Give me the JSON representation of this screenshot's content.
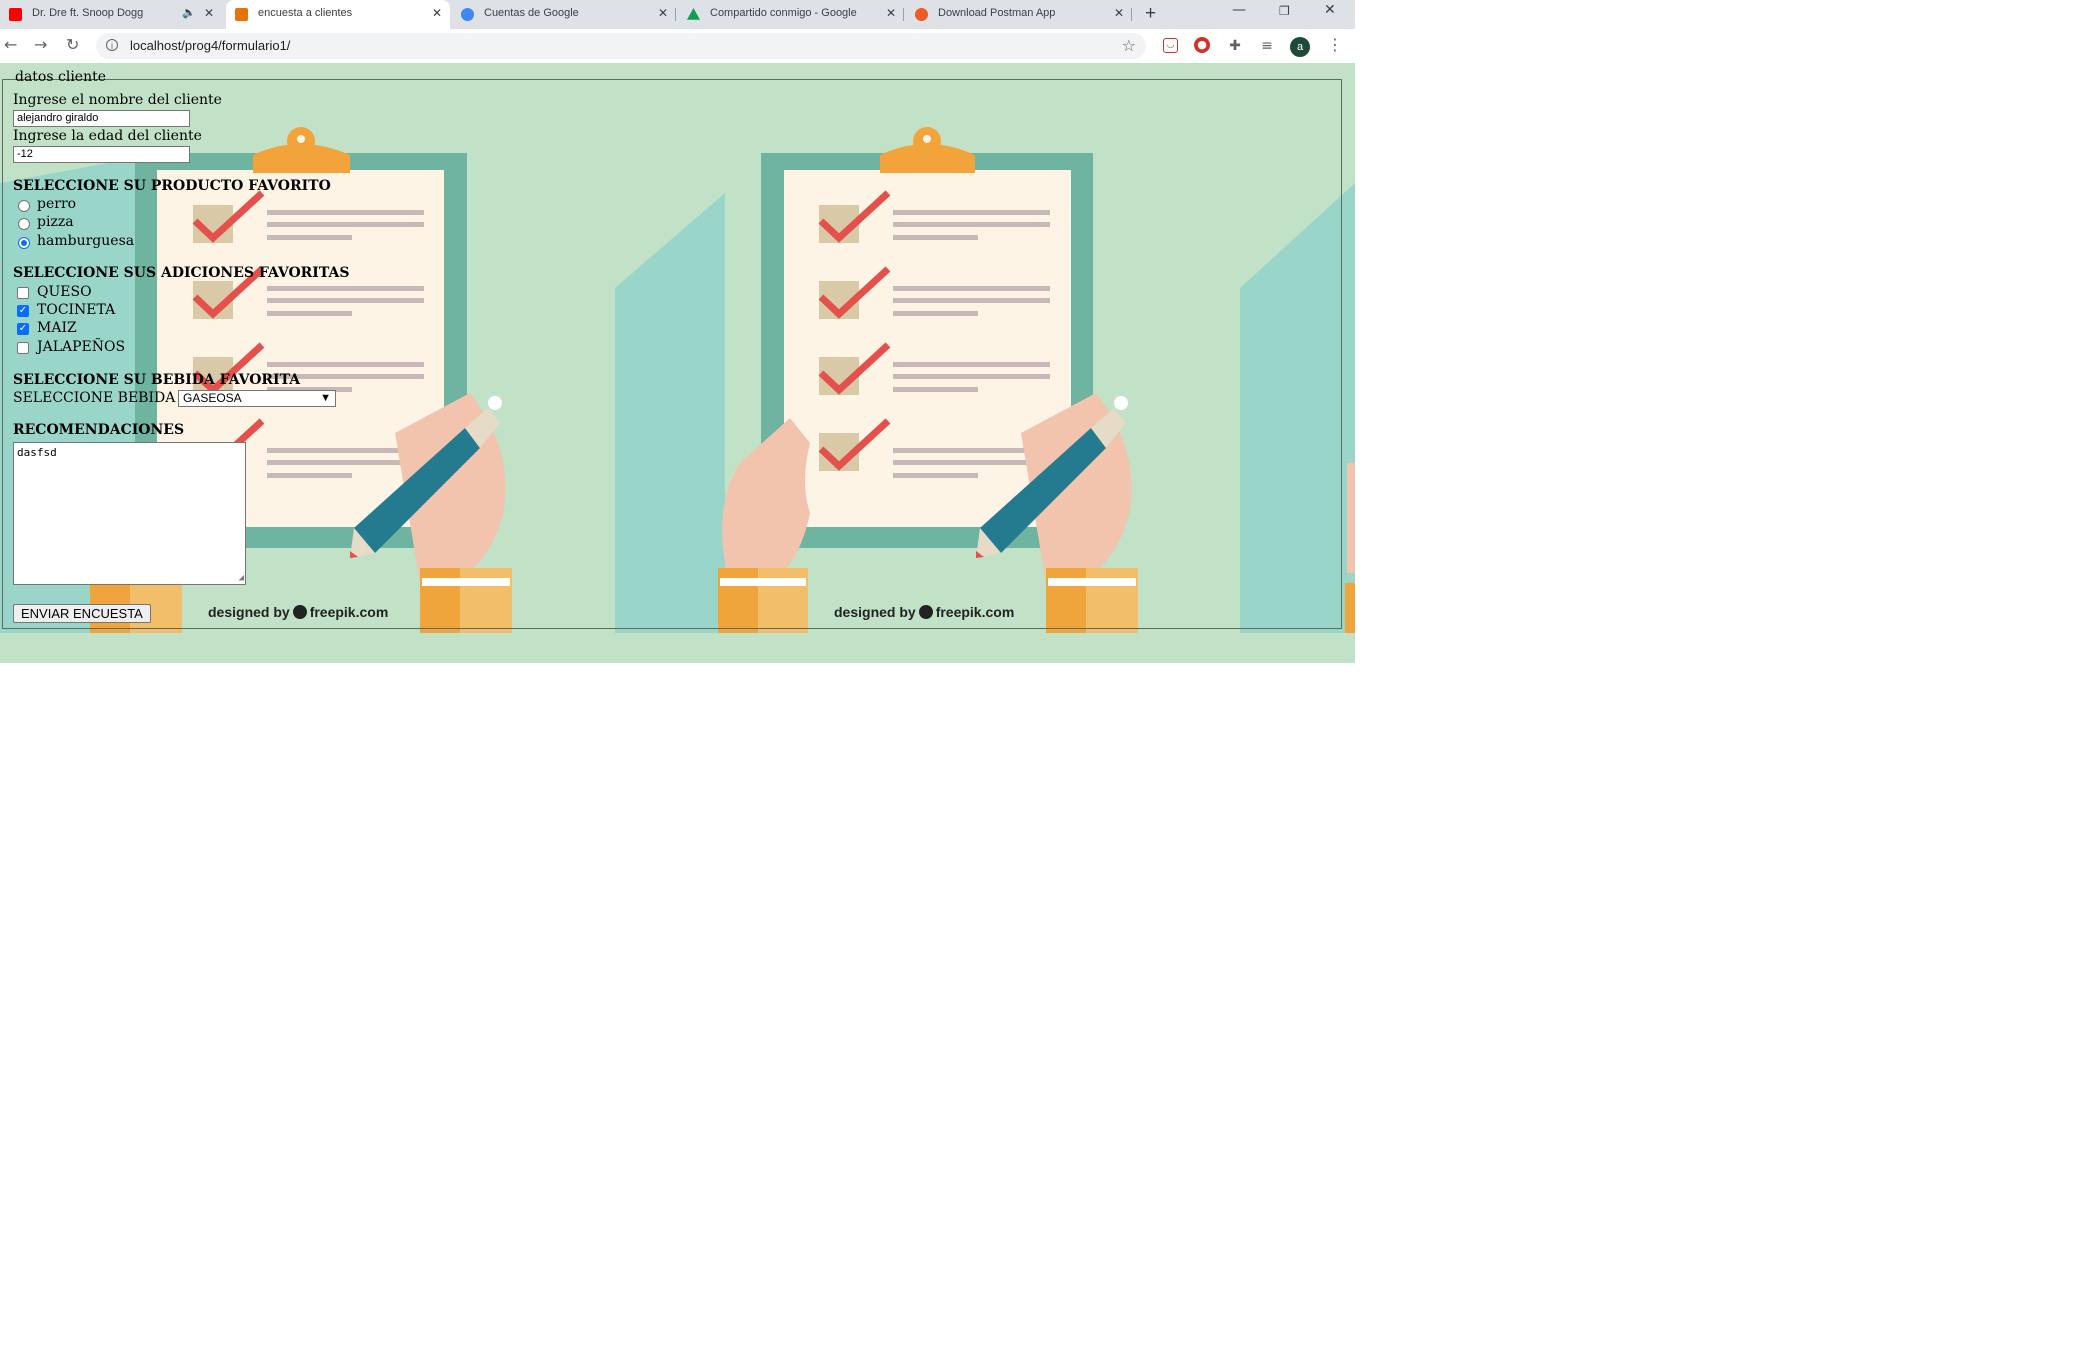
{
  "browser": {
    "tabs": [
      {
        "title": "Dr. Dre ft. Snoop Dogg",
        "favicon_color": "#ff0000",
        "icon": "youtube-icon"
      },
      {
        "title": "encuesta a clientes",
        "favicon_color": "#e8710a",
        "icon": "page-icon"
      },
      {
        "title": "Cuentas de Google",
        "favicon_color": "#4285f4",
        "icon": "google-icon"
      },
      {
        "title": "Compartido conmigo - Google",
        "favicon_color": "#0f9d58",
        "icon": "drive-icon"
      },
      {
        "title": "Download Postman App",
        "favicon_color": "#ef5b25",
        "icon": "postman-icon"
      }
    ],
    "active_tab": 1,
    "url": "localhost/prog4/formulario1/",
    "profile_initial": "a"
  },
  "form": {
    "legend": "datos cliente",
    "nombre": {
      "label": "Ingrese el nombre del cliente",
      "value": "alejandro giraldo"
    },
    "edad": {
      "label": "Ingrese la edad del cliente",
      "value": "-12"
    },
    "producto": {
      "heading": "SELECCIONE SU PRODUCTO FAVORITO",
      "options": [
        {
          "label": "perro",
          "checked": false
        },
        {
          "label": "pizza",
          "checked": false
        },
        {
          "label": "hamburguesa",
          "checked": true
        }
      ]
    },
    "adiciones": {
      "heading": "SELECCIONE SUS ADICIONES FAVORITAS",
      "options": [
        {
          "label": "QUESO",
          "checked": false
        },
        {
          "label": "TOCINETA",
          "checked": true
        },
        {
          "label": "MAIZ",
          "checked": true
        },
        {
          "label": "JALAPEÑOS",
          "checked": false
        }
      ]
    },
    "bebida": {
      "heading": "SELECCIONE SU BEBIDA FAVORITA",
      "label": "SELECCIONE BEBIDA",
      "selected": "GASEOSA"
    },
    "recomendaciones": {
      "heading": "RECOMENDACIONES",
      "value": "dasfsd"
    },
    "submit_label": "ENVIAR ENCUESTA"
  },
  "background": {
    "credit_prefix": "designed by",
    "credit_brand": "freepik.com"
  }
}
